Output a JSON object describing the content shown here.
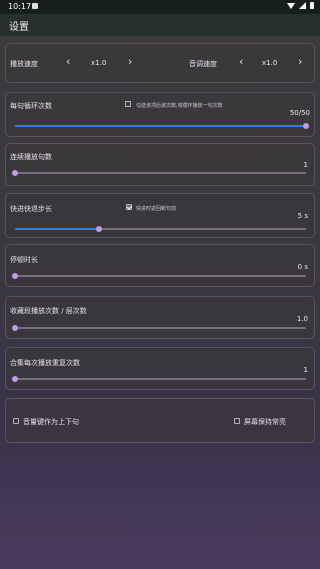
{
  "status": {
    "time": "10:17"
  },
  "app": {
    "title": "设置"
  },
  "speeds": {
    "playback": {
      "label": "播放速度",
      "value": "x1.0"
    },
    "pitch": {
      "label": "音调速度",
      "value": "x1.0"
    }
  },
  "loop": {
    "label": "每句循环次数",
    "checkbox_label": "勾选该项后该次数,将循环播放一句次数",
    "checkbox_checked": false,
    "value_text": "50/50",
    "fraction": 1.0
  },
  "continuous": {
    "label": "连续播放句数",
    "value_text": "1",
    "fraction": 0.0
  },
  "step": {
    "label": "快进快退步长",
    "checkbox_label": "快进时返回断句前",
    "checkbox_checked": true,
    "value_text": "5 s",
    "fraction": 0.29
  },
  "pause": {
    "label": "停顿时长",
    "value_text": "0 s",
    "fraction": 0.0
  },
  "favorites": {
    "label": "收藏段播放次数 / 层次数",
    "value_text": "1.0",
    "fraction": 0.0
  },
  "collection": {
    "label": "合集每次播放重复次数",
    "value_text": "1",
    "fraction": 0.0
  },
  "options": {
    "volume_keys": {
      "label": "音量键作为上下句",
      "checked": false
    },
    "keep_screen": {
      "label": "屏幕保持常亮",
      "checked": false
    }
  },
  "colors": {
    "accent": "#3d7bd1",
    "thumb": "#c39be6"
  }
}
